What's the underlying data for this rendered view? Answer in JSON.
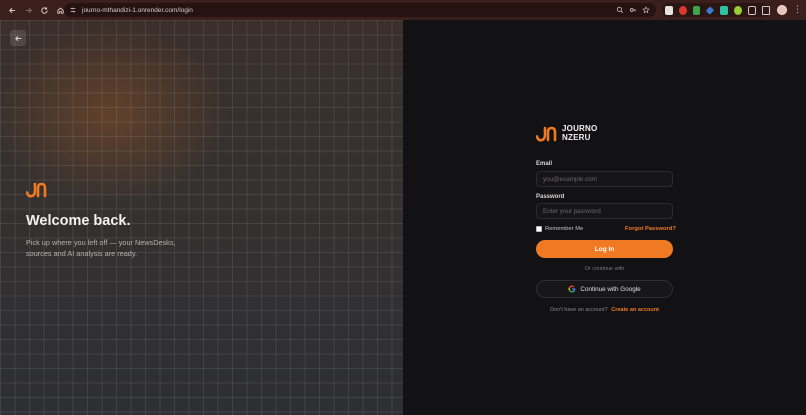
{
  "browser": {
    "url": "journo-mthandizi-1.onrender.com/login"
  },
  "left_panel": {
    "heading": "Welcome back.",
    "tagline": "Pick up where you left off — your NewsDesks, sources and AI analysis are ready."
  },
  "brand": {
    "line1": "JOURNO",
    "line2": "NZERU"
  },
  "form": {
    "email_label": "Email",
    "email_placeholder": "you@example.com",
    "password_label": "Password",
    "password_placeholder": "Enter your password",
    "remember_label": "Remember Me",
    "forgot_link": "Forgot Password?",
    "login_button": "Log In",
    "divider": "Or continue with",
    "google_button": "Continue with Google",
    "signup_prompt": "Don't have an account?",
    "signup_link": "Create an account"
  },
  "colors": {
    "accent": "#f07a23",
    "right_bg": "#121113",
    "chrome_bg": "#3a1f1c"
  },
  "icons": [
    "back-arrow-icon",
    "forward-arrow-icon",
    "reload-icon",
    "home-icon",
    "site-info-icon",
    "zoom-icon",
    "password-key-icon",
    "bookmark-star-icon",
    "google-icon",
    "brand-logo"
  ]
}
